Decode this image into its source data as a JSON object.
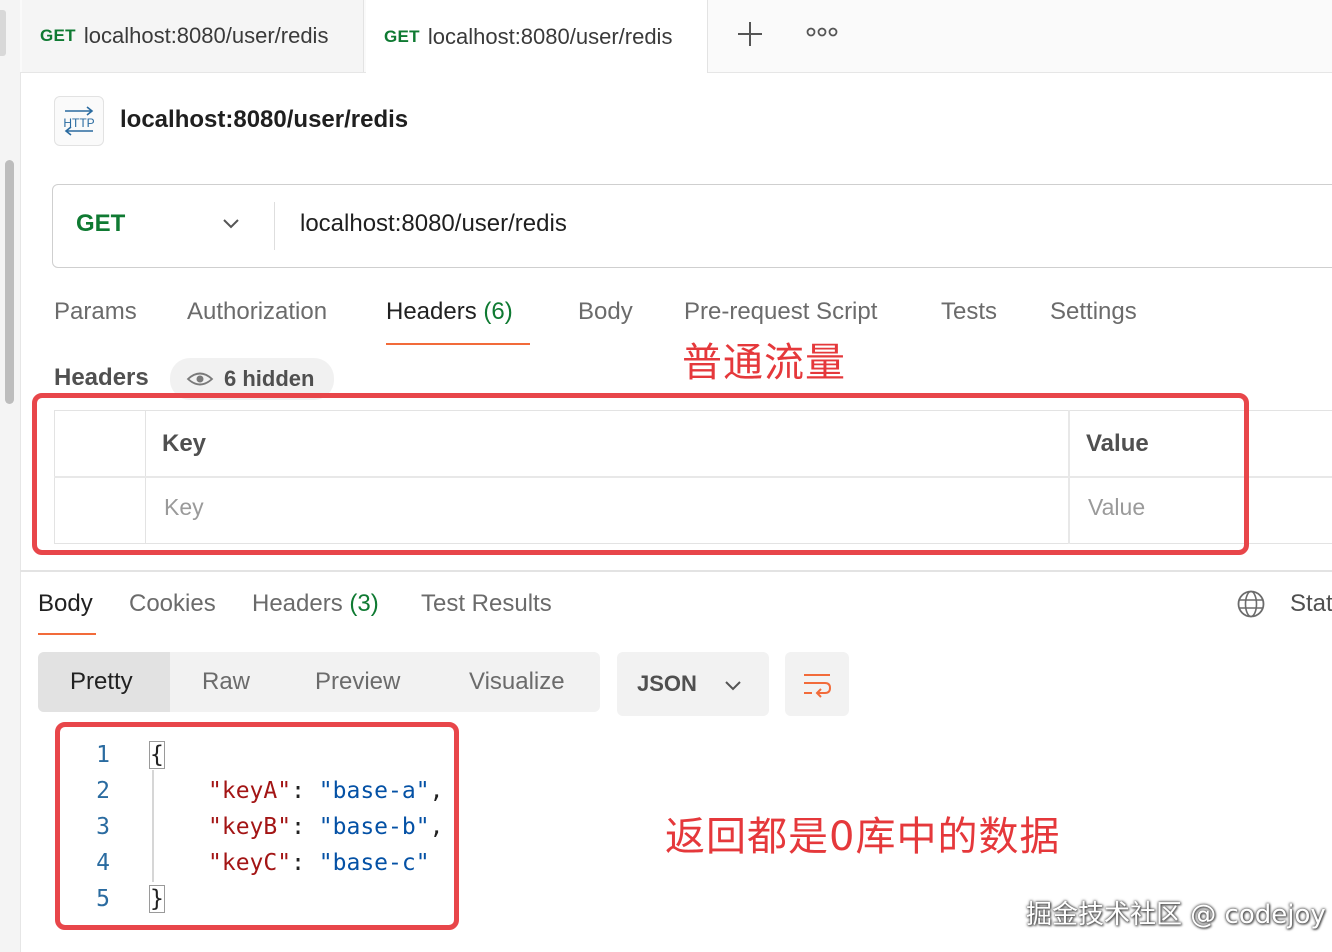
{
  "tabs": [
    {
      "method": "GET",
      "url": "localhost:8080/user/redis"
    },
    {
      "method": "GET",
      "url": "localhost:8080/user/redis"
    }
  ],
  "tabbar": {
    "new_tab": "+",
    "more": "ooo"
  },
  "request": {
    "title": "localhost:8080/user/redis",
    "method": "GET",
    "url": "localhost:8080/user/redis",
    "icon_text": "HTTP"
  },
  "request_tabs": {
    "params": "Params",
    "authorization": "Authorization",
    "headers": "Headers",
    "headers_count": "(6)",
    "body": "Body",
    "prerequest": "Pre-request Script",
    "tests": "Tests",
    "settings": "Settings"
  },
  "headers_section": {
    "label": "Headers",
    "hidden": "6 hidden",
    "col_key": "Key",
    "col_value": "Value",
    "placeholder_key": "Key",
    "placeholder_value": "Value"
  },
  "annotations": {
    "top": "普通流量",
    "bottom": "返回都是0库中的数据"
  },
  "response_tabs": {
    "body": "Body",
    "cookies": "Cookies",
    "headers": "Headers",
    "headers_count": "(3)",
    "test_results": "Test Results",
    "status": "Stat"
  },
  "view_modes": {
    "pretty": "Pretty",
    "raw": "Raw",
    "preview": "Preview",
    "visualize": "Visualize"
  },
  "format": "JSON",
  "code": {
    "line_numbers": [
      "1",
      "2",
      "3",
      "4",
      "5"
    ],
    "open": "{",
    "close": "}",
    "entries": [
      {
        "key": "\"keyA\"",
        "value": "\"base-a\"",
        "sep": ","
      },
      {
        "key": "\"keyB\"",
        "value": "\"base-b\"",
        "sep": ","
      },
      {
        "key": "\"keyC\"",
        "value": "\"base-c\"",
        "sep": ""
      }
    ]
  },
  "watermark": "掘金技术社区 @ codejoy",
  "colors": {
    "accent": "#f26b3a",
    "get_green": "#0f7a32",
    "annotation_red": "#e8464a"
  }
}
